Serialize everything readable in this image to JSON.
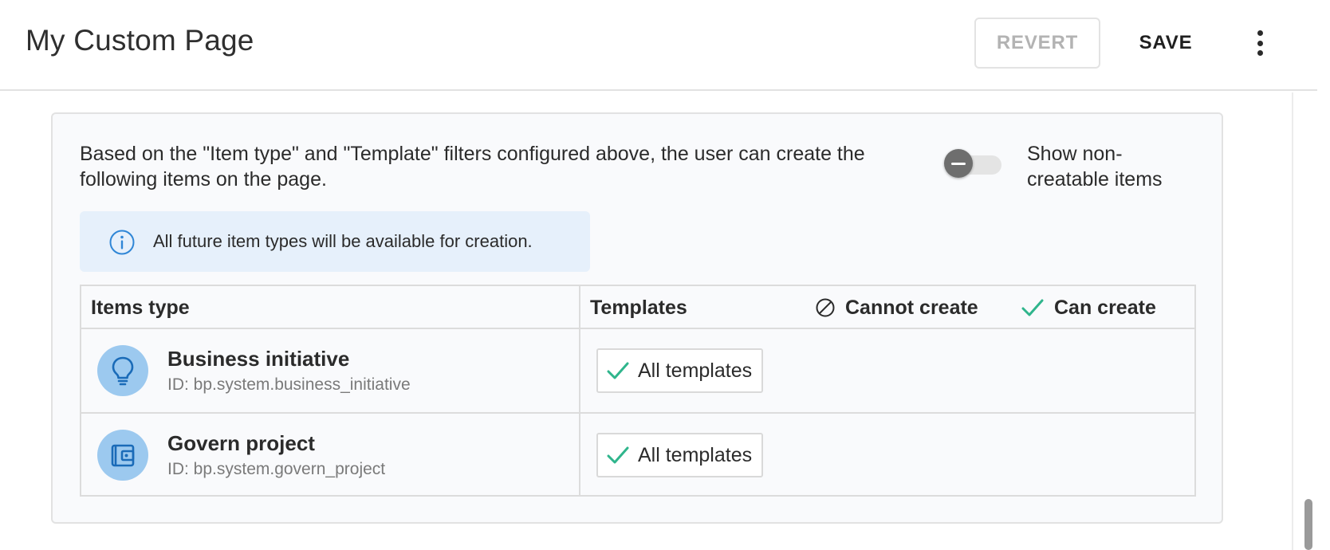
{
  "header": {
    "title": "My Custom Page",
    "revert_label": "REVERT",
    "save_label": "SAVE",
    "more_icon": "more-vertical-icon"
  },
  "panel": {
    "description": "Based on the \"Item type\" and \"Template\" filters configured above, the user can create the following items on the page.",
    "toggle": {
      "label": "Show non-creatable items",
      "checked": false
    },
    "info": {
      "icon": "info-icon",
      "text": "All future item types will be available for creation."
    },
    "table": {
      "headers": {
        "items_type": "Items type",
        "templates": "Templates"
      },
      "legend": {
        "cannot_create": "Cannot create",
        "can_create": "Can create"
      },
      "rows": [
        {
          "icon": "lightbulb-icon",
          "name": "Business initiative",
          "id": "ID: bp.system.business_initiative",
          "template": "All templates"
        },
        {
          "icon": "wallet-icon",
          "name": "Govern project",
          "id": "ID: bp.system.govern_project",
          "template": "All templates"
        }
      ]
    }
  },
  "colors": {
    "accent_check": "#2fb58c",
    "avatar_bg": "#9cc9ef",
    "avatar_fg": "#1a6bb8",
    "info_bg": "#e6f0fb"
  }
}
